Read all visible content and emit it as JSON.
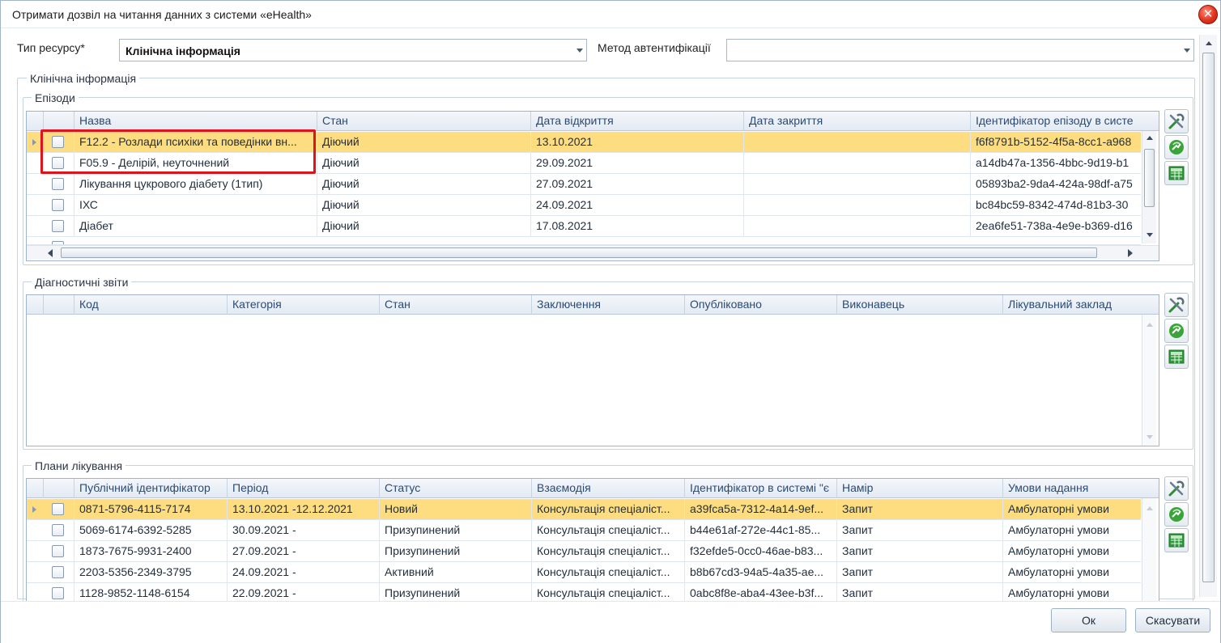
{
  "window": {
    "title": "Отримати дозвіл на читання данних з системи «eHealth»",
    "close_glyph": "✕"
  },
  "filters": {
    "resource_type_label": "Тип ресурсу*",
    "resource_type_value": "Клінічна інформація",
    "auth_method_label": "Метод автентифікації",
    "auth_method_value": ""
  },
  "clinical_group": {
    "title": "Клінічна інформація"
  },
  "episodes": {
    "title": "Епізоди",
    "columns": [
      "Назва",
      "Стан",
      "Дата відкриття",
      "Дата закриття",
      "Ідентифікатор епізоду в систе"
    ],
    "rows": [
      [
        "F12.2 - Розлади психіки та поведінки вн...",
        "Діючий",
        "13.10.2021",
        "",
        "f6f8791b-5152-4f5a-8cc1-a968"
      ],
      [
        "F05.9 - Делірій, неуточнений",
        "Діючий",
        "29.09.2021",
        "",
        "a14db47a-1356-4bbc-9d19-b1"
      ],
      [
        "Лікування цукрового діабету (1тип)",
        "Діючий",
        "27.09.2021",
        "",
        "05893ba2-9da4-424a-98df-a75"
      ],
      [
        "ІХС",
        "Діючий",
        "24.09.2021",
        "",
        "bc84bc59-8342-474d-81b3-30"
      ],
      [
        "Діабет",
        "Діючий",
        "17.08.2021",
        "",
        "2ea6fe51-738a-4e9e-b369-d16"
      ]
    ]
  },
  "reports": {
    "title": "Діагностичні звіти",
    "columns": [
      "Код",
      "Категорія",
      "Стан",
      "Заключення",
      "Опубліковано",
      "Виконавець",
      "Лікувальний заклад"
    ]
  },
  "plans": {
    "title": "Плани лікування",
    "columns": [
      "Публічний ідентифікатор",
      "Період",
      "Статус",
      "Взаємодія",
      "Ідентифікатор в системі \"є",
      "Намір",
      "Умови надання"
    ],
    "rows": [
      [
        "0871-5796-4115-7174",
        "13.10.2021 -12.12.2021",
        "Новий",
        "Консультація спеціаліст...",
        "a39fca5a-7312-4a14-9ef...",
        "Запит",
        "Амбулаторні умови"
      ],
      [
        "5069-6174-6392-5285",
        "30.09.2021 -",
        "Призупинений",
        "Консультація спеціаліст...",
        "b44e61af-272e-44c1-85...",
        "Запит",
        "Амбулаторні умови"
      ],
      [
        "1873-7675-9931-2400",
        "27.09.2021 -",
        "Призупинений",
        "Консультація спеціаліст...",
        "f32efde5-0cc0-46ae-b83...",
        "Запит",
        "Амбулаторні умови"
      ],
      [
        "2203-5356-2349-3795",
        "24.09.2021 -",
        "Активний",
        "Консультація спеціаліст...",
        "b8b67cd3-94a5-4a35-ae...",
        "Запит",
        "Амбулаторні умови"
      ],
      [
        "1128-9852-1148-6154",
        "22.09.2021 -",
        "Призупинений",
        "Консультація спеціаліст...",
        "0abc8f8e-aba4-43ee-b3f...",
        "Запит",
        "Амбулаторні умови"
      ]
    ]
  },
  "footer": {
    "ok_label": "Ок",
    "cancel_label": "Скасувати"
  },
  "colors": {
    "selected_row": "#fddd7f",
    "highlight_border": "#e0121b",
    "header_text": "#2a4a73"
  },
  "icons": [
    "close-icon",
    "tools-icon",
    "refresh-link-icon",
    "table-export-icon",
    "chevron-down-icon"
  ]
}
